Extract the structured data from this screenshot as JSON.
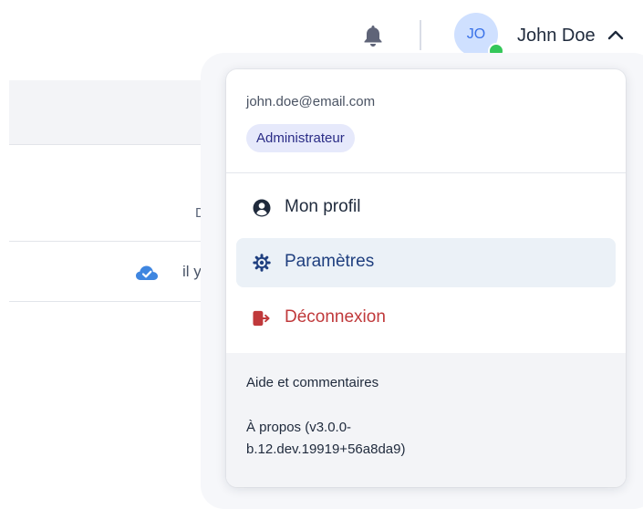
{
  "header": {
    "user_name": "John Doe",
    "avatar_initials": "JO",
    "status": "online",
    "icons": [
      "bell-icon",
      "chevron-up-icon"
    ]
  },
  "background": {
    "column_header": "Derr",
    "cell_text": "il y",
    "icons": [
      "cloud-check-icon",
      "list-toggle-icon"
    ]
  },
  "dropdown": {
    "email": "john.doe@email.com",
    "role": "Administrateur",
    "items": [
      {
        "label": "Mon profil",
        "icon": "user-circle-icon"
      },
      {
        "label": "Paramètres",
        "icon": "gear-icon",
        "highlighted": true
      },
      {
        "label": "Déconnexion",
        "icon": "logout-icon"
      }
    ],
    "footer": {
      "help": "Aide et commentaires",
      "about_line1": "À propos (v3.0.0-",
      "about_line2": "b.12.dev.19919+56a8da9)"
    }
  },
  "colors": {
    "accent": "#3a72e8",
    "highlight_bg": "#ebf1f7",
    "logout": "#c0393b",
    "badge_bg": "#e6e9fb",
    "status_online": "#34c759"
  }
}
